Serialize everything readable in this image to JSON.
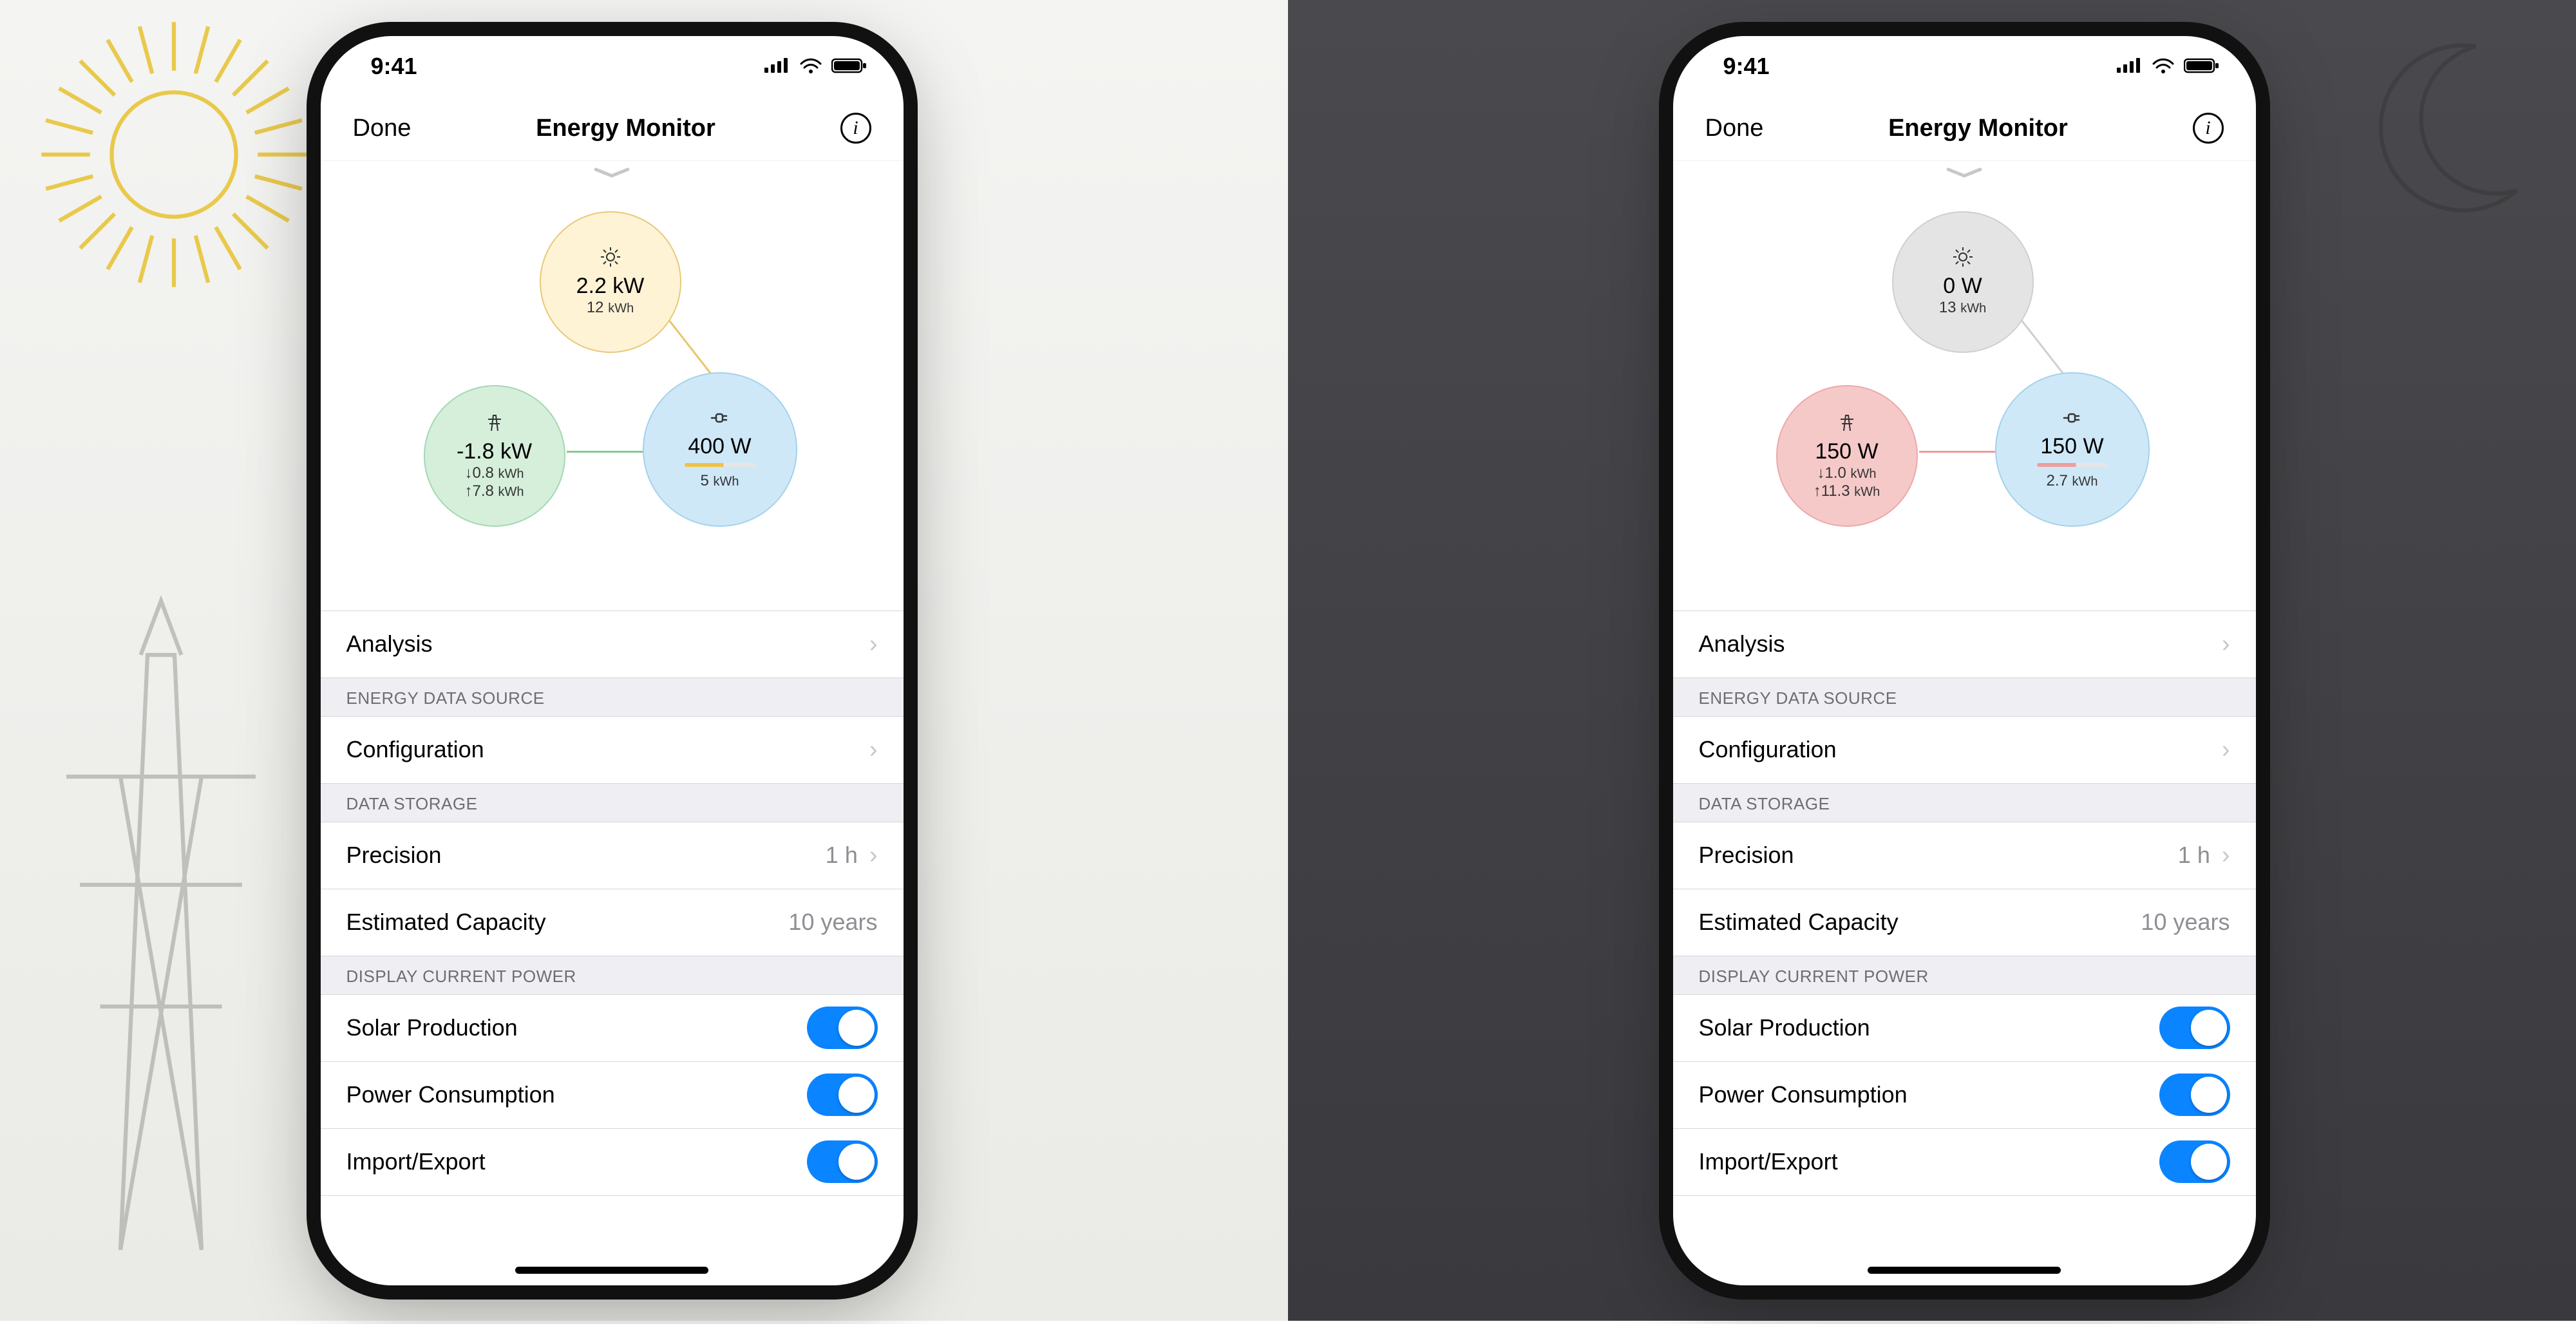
{
  "status": {
    "time": "9:41"
  },
  "nav": {
    "done": "Done",
    "title": "Energy Monitor"
  },
  "day": {
    "solar": {
      "power": "2.2 kW",
      "energy_val": "12",
      "energy_unit": "kWh"
    },
    "grid": {
      "power": "-1.8 kW",
      "import_val": "0.8",
      "export_val": "7.8",
      "unit": "kWh"
    },
    "home": {
      "power": "400 W",
      "energy_val": "5",
      "energy_unit": "kWh"
    }
  },
  "night": {
    "solar": {
      "power": "0 W",
      "energy_val": "13",
      "energy_unit": "kWh"
    },
    "grid": {
      "power": "150 W",
      "import_val": "1.0",
      "export_val": "11.3",
      "unit": "kWh"
    },
    "home": {
      "power": "150 W",
      "energy_val": "2.7",
      "energy_unit": "kWh"
    }
  },
  "rows": {
    "analysis": "Analysis",
    "section_source": "ENERGY DATA SOURCE",
    "configuration": "Configuration",
    "section_storage": "DATA STORAGE",
    "precision_label": "Precision",
    "precision_value": "1 h",
    "capacity_label": "Estimated Capacity",
    "capacity_value": "10 years",
    "section_display": "DISPLAY CURRENT POWER",
    "solar_prod": "Solar Production",
    "power_cons": "Power Consumption",
    "import_export": "Import/Export"
  },
  "chart_data": [
    {
      "type": "diagram",
      "label": "day",
      "nodes": {
        "solar": {
          "power_kw": 2.2,
          "energy_kwh": 12
        },
        "grid": {
          "power_kw": -1.8,
          "import_kwh": 0.8,
          "export_kwh": 7.8
        },
        "home": {
          "power_w": 400,
          "energy_kwh": 5
        }
      },
      "flows": [
        {
          "from": "solar",
          "to": "home"
        },
        {
          "from": "grid",
          "to": "home"
        }
      ]
    },
    {
      "type": "diagram",
      "label": "night",
      "nodes": {
        "solar": {
          "power_w": 0,
          "energy_kwh": 13
        },
        "grid": {
          "power_w": 150,
          "import_kwh": 1.0,
          "export_kwh": 11.3
        },
        "home": {
          "power_w": 150,
          "energy_kwh": 2.7
        }
      },
      "flows": [
        {
          "from": "solar",
          "to": "home"
        },
        {
          "from": "grid",
          "to": "home"
        }
      ]
    }
  ]
}
